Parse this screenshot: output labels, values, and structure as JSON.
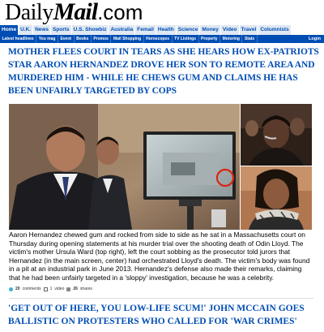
{
  "logo": {
    "daily": "Daily",
    "mail": "Mail",
    "com": ".com"
  },
  "nav_primary": [
    "Home",
    "U.K.",
    "News",
    "Sports",
    "U.S. Showbiz",
    "Australia",
    "Femail",
    "Health",
    "Science",
    "Money",
    "Video",
    "Travel",
    "Columnists"
  ],
  "nav_secondary": [
    "Latest headlines",
    "You mag",
    "Event",
    "Books",
    "Promos",
    "Mail Shopping",
    "Horoscopes",
    "TV Listings",
    "Property",
    "Motoring",
    "Stats"
  ],
  "login_label": "Login",
  "article": {
    "headline": "Mother flees court in tears as she hears how ex-Patriots star Aaron Hernandez drove her son to remote area and murdered him - while he chews gum and claims he has been UNFAIRLY targeted by cops",
    "caption": "Aaron Hernandez chewed gum and rocked from side to side as he sat in a Massachusetts court on Thursday during opening statements at his murder trial over the shooting death of Odin Lloyd. The victim's mother Ursula Ward (top right), left the court sobbing as the prosecutor told jurors that Hernandez (in the main screen, center) had orchestrated Lloyd's death. The victim's body was found in a pit at an industrial park in June 2013. Hernandez's defense also made their remarks, claiming that he had been unfairly targeted in a 'sloppy' investigation, because he was a celebrity.",
    "comments_count": "20",
    "comments_label": "comments",
    "video_count": "1",
    "video_label": "video",
    "shares_count": "26",
    "shares_label": "shares"
  },
  "next_headline": "'Get out of here, you low-life scum!' John McCain goes ballistic on protesters who called for 'war crimes'",
  "colors": {
    "brand_blue": "#004db3",
    "nav_tab_bg": "#dfe8f3"
  }
}
